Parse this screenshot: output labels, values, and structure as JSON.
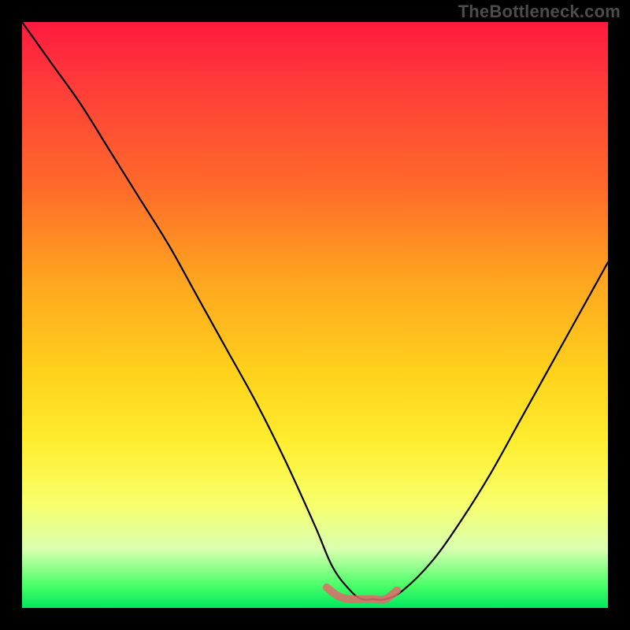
{
  "watermark": "TheBottleneck.com",
  "chart_data": {
    "type": "line",
    "title": "",
    "xlabel": "",
    "ylabel": "",
    "xlim": [
      0,
      100
    ],
    "ylim": [
      0,
      100
    ],
    "grid": false,
    "legend": false,
    "series": [
      {
        "name": "bottleneck-curve",
        "x": [
          0,
          5,
          10,
          15,
          20,
          25,
          30,
          35,
          40,
          45,
          50,
          53,
          56,
          58,
          60,
          62,
          65,
          70,
          75,
          80,
          85,
          90,
          95,
          100
        ],
        "values": [
          100,
          93,
          86,
          78,
          70,
          62,
          53,
          44,
          35,
          25,
          14,
          7,
          3,
          1.5,
          1.5,
          1.5,
          3,
          8,
          15,
          23,
          32,
          41,
          50,
          59
        ]
      },
      {
        "name": "minimum-marker",
        "x": [
          52,
          54,
          56,
          58,
          60,
          62,
          64
        ],
        "values": [
          3.5,
          2.0,
          1.5,
          1.5,
          1.5,
          1.5,
          3.0
        ]
      }
    ],
    "colors": {
      "curve": "#000000",
      "marker": "#e06a6a",
      "background_top": "#ff1a3f",
      "background_bottom": "#00e85c"
    }
  }
}
